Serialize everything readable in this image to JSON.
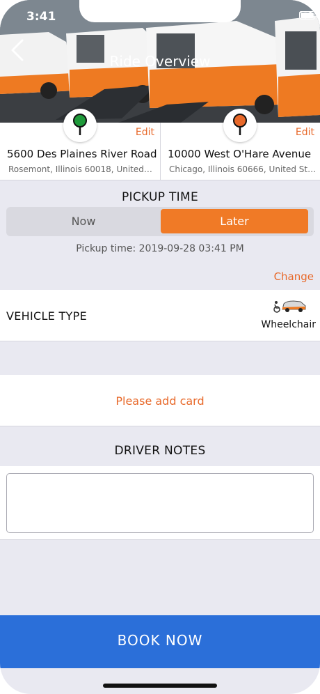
{
  "status_bar": {
    "time": "3:41"
  },
  "header": {
    "title": "Ride Overview"
  },
  "addresses": {
    "pickup": {
      "edit_label": "Edit",
      "name": "5600 Des Plaines River Road",
      "detail": "Rosemont, Illinois 60018, United…",
      "pin_color": "#1f9a3a"
    },
    "dropoff": {
      "edit_label": "Edit",
      "name": "10000 West O'Hare Avenue",
      "detail": "Chicago, Illinois 60666, United St…",
      "pin_color": "#e8692a"
    }
  },
  "pickup_time": {
    "heading": "PICKUP TIME",
    "options": [
      "Now",
      "Later"
    ],
    "selected": "Later",
    "info": "Pickup time: 2019-09-28 03:41 PM",
    "change_label": "Change"
  },
  "vehicle": {
    "label": "VEHICLE TYPE",
    "value": "Wheelchair",
    "icon": "wheelchair-van-icon"
  },
  "payment": {
    "add_card_label": "Please add card"
  },
  "driver_notes": {
    "heading": "DRIVER NOTES",
    "value": "",
    "placeholder": ""
  },
  "actions": {
    "book_label": "BOOK NOW"
  },
  "colors": {
    "accent": "#f07a26",
    "link": "#e8692a",
    "book": "#2b6fd9",
    "background": "#e9e9f1"
  }
}
